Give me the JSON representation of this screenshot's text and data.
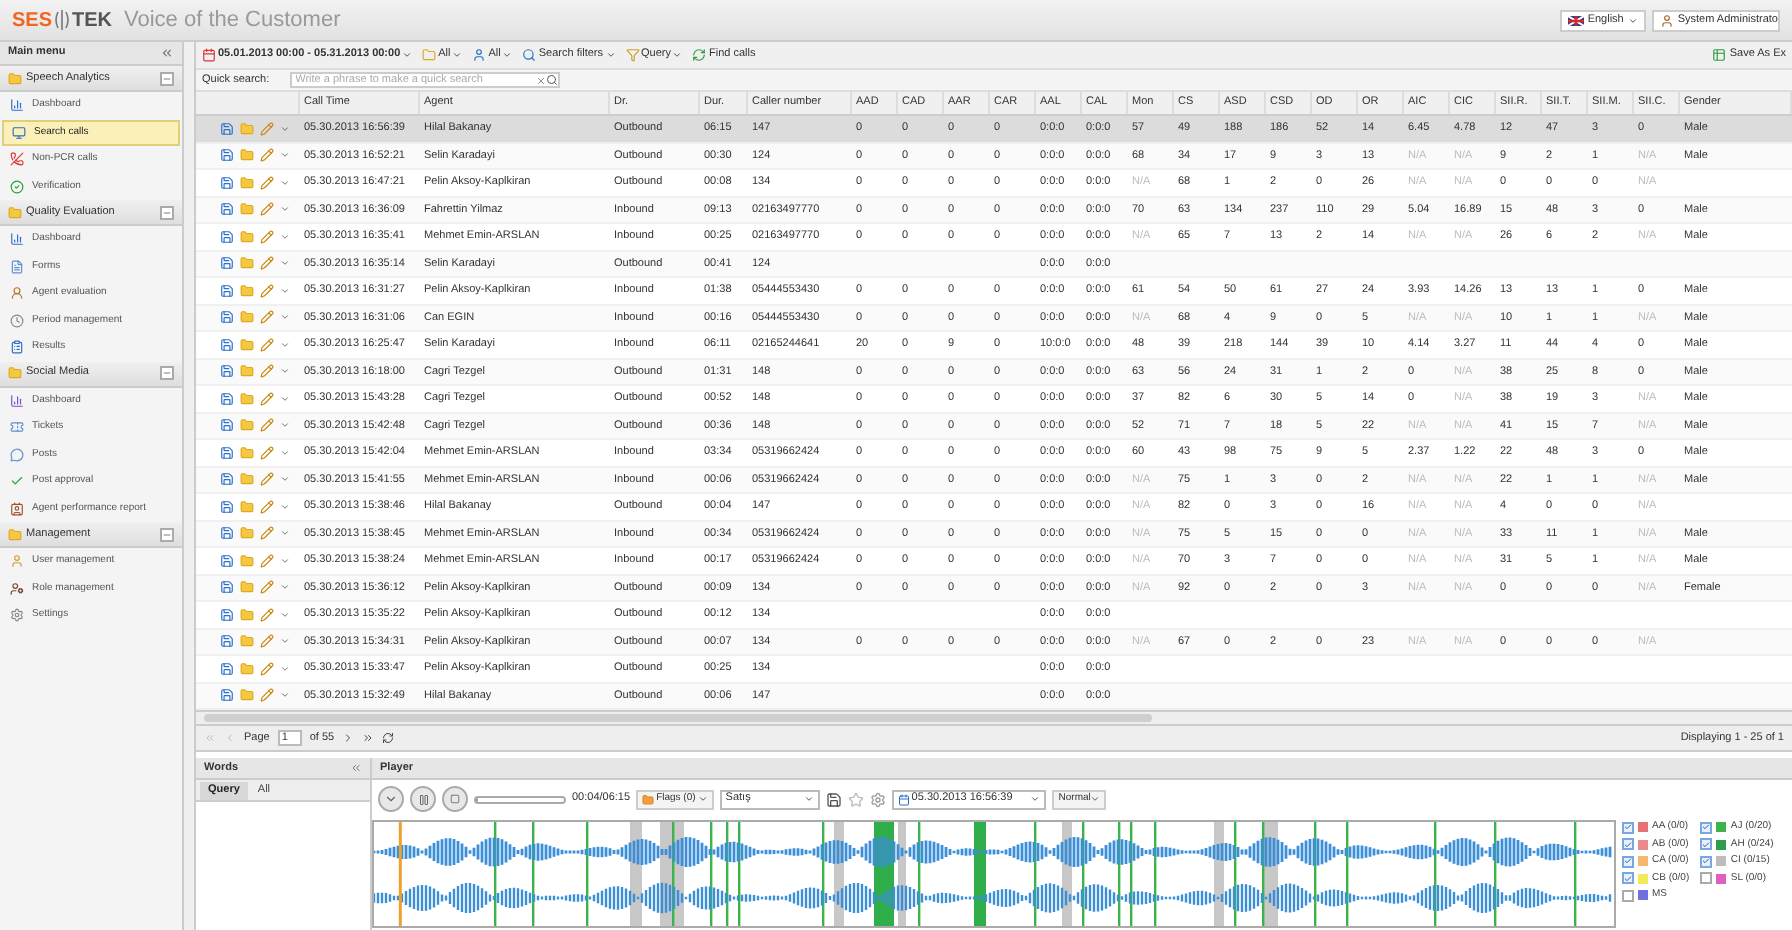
{
  "header": {
    "logo_left": "SES",
    "logo_right": "TEK",
    "title": "Voice of the Customer",
    "language": "English",
    "user": "System Administrato"
  },
  "sidebar": {
    "title": "Main menu",
    "groups": [
      {
        "label": "Speech Analytics",
        "expanded": true,
        "items": [
          {
            "label": "Dashboard",
            "selected": false
          },
          {
            "label": "Search calls",
            "selected": true
          },
          {
            "label": "Non-PCR calls",
            "selected": false
          },
          {
            "label": "Verification",
            "selected": false
          }
        ]
      },
      {
        "label": "Quality Evaluation",
        "expanded": true,
        "items": [
          {
            "label": "Dashboard",
            "selected": false
          },
          {
            "label": "Forms",
            "selected": false
          },
          {
            "label": "Agent evaluation",
            "selected": false
          },
          {
            "label": "Period management",
            "selected": false
          },
          {
            "label": "Results",
            "selected": false
          }
        ]
      },
      {
        "label": "Social Media",
        "expanded": true,
        "items": [
          {
            "label": "Dashboard",
            "selected": false
          },
          {
            "label": "Tickets",
            "selected": false
          },
          {
            "label": "Posts",
            "selected": false
          },
          {
            "label": "Post approval",
            "selected": false
          },
          {
            "label": "Agent performance report",
            "selected": false
          }
        ]
      },
      {
        "label": "Management",
        "expanded": true,
        "items": [
          {
            "label": "User management",
            "selected": false
          },
          {
            "label": "Role management",
            "selected": false
          },
          {
            "label": "Settings",
            "selected": false
          }
        ]
      }
    ]
  },
  "toolbar": {
    "date_range": "05.01.2013 00:00 - 05.31.2013 00:00",
    "filters": [
      "All",
      "All",
      "Search filters",
      "Query"
    ],
    "find": "Find calls",
    "export": "Save As Ex"
  },
  "quick_search": {
    "label": "Quick search:",
    "placeholder": "Write a phrase to make a quick search"
  },
  "table": {
    "columns": [
      "Call Time",
      "Agent",
      "Dr.",
      "Dur.",
      "Caller number",
      "AAD",
      "CAD",
      "AAR",
      "CAR",
      "AAL",
      "CAL",
      "Mon",
      "CS",
      "ASD",
      "CSD",
      "OD",
      "OR",
      "AIC",
      "CIC",
      "SII.R.",
      "SII.T.",
      "SII.M.",
      "SII.C.",
      "Gender"
    ],
    "rows": [
      {
        "selected": true,
        "cells": [
          "05.30.2013 16:56:39",
          "Hilal Bakanay",
          "Outbound",
          "06:15",
          "147",
          "0",
          "0",
          "0",
          "0",
          "0:0:0",
          "0:0:0",
          "57",
          "49",
          "188",
          "186",
          "52",
          "14",
          "6.45",
          "4.78",
          "12",
          "47",
          "3",
          "0",
          "Male"
        ]
      },
      {
        "selected": false,
        "cells": [
          "05.30.2013 16:52:21",
          "Selin Karadayi",
          "Outbound",
          "00:30",
          "124",
          "0",
          "0",
          "0",
          "0",
          "0:0:0",
          "0:0:0",
          "68",
          "34",
          "17",
          "9",
          "3",
          "13",
          {
            "text": "N/A",
            "dimmed": true
          },
          {
            "text": "N/A",
            "dimmed": true
          },
          "9",
          "2",
          "1",
          {
            "text": "N/A",
            "dimmed": true
          },
          "Male"
        ]
      },
      {
        "selected": false,
        "cells": [
          "05.30.2013 16:47:21",
          "Pelin Aksoy-Kaplkiran",
          "Outbound",
          "00:08",
          "134",
          "0",
          "0",
          "0",
          "0",
          "0:0:0",
          "0:0:0",
          {
            "text": "N/A",
            "dimmed": true
          },
          "68",
          "1",
          "2",
          "0",
          "26",
          {
            "text": "N/A",
            "dimmed": true
          },
          {
            "text": "N/A",
            "dimmed": true
          },
          "0",
          "0",
          "0",
          {
            "text": "N/A",
            "dimmed": true
          },
          null
        ]
      },
      {
        "selected": false,
        "cells": [
          "05.30.2013 16:36:09",
          "Fahrettin Yilmaz",
          "Inbound",
          "09:13",
          "02163497770",
          "0",
          "0",
          "0",
          "0",
          "0:0:0",
          "0:0:0",
          "70",
          "63",
          "134",
          "237",
          "110",
          "29",
          "5.04",
          "16.89",
          "15",
          "48",
          "3",
          "0",
          "Male"
        ]
      },
      {
        "selected": false,
        "cells": [
          "05.30.2013 16:35:41",
          "Mehmet Emin-ARSLAN",
          "Inbound",
          "00:25",
          "02163497770",
          "0",
          "0",
          "0",
          "0",
          "0:0:0",
          "0:0:0",
          {
            "text": "N/A",
            "dimmed": true
          },
          "65",
          "7",
          "13",
          "2",
          "14",
          {
            "text": "N/A",
            "dimmed": true
          },
          {
            "text": "N/A",
            "dimmed": true
          },
          "26",
          "6",
          "2",
          {
            "text": "N/A",
            "dimmed": true
          },
          "Male"
        ]
      },
      {
        "selected": false,
        "cells": [
          "05.30.2013 16:35:14",
          "Selin Karadayi",
          "Outbound",
          "00:41",
          "124",
          null,
          null,
          null,
          null,
          "0:0:0",
          "0:0:0",
          null,
          null,
          null,
          null,
          null,
          null,
          null,
          null,
          null,
          null,
          null,
          null,
          null
        ]
      },
      {
        "selected": false,
        "cells": [
          "05.30.2013 16:31:27",
          "Pelin Aksoy-Kaplkiran",
          "Inbound",
          "01:38",
          "05444553430",
          "0",
          "0",
          "0",
          "0",
          "0:0:0",
          "0:0:0",
          "61",
          "54",
          "50",
          "61",
          "27",
          "24",
          "3.93",
          "14.26",
          "13",
          "13",
          "1",
          "0",
          "Male"
        ]
      },
      {
        "selected": false,
        "cells": [
          "05.30.2013 16:31:06",
          "Can EGIN",
          "Inbound",
          "00:16",
          "05444553430",
          "0",
          "0",
          "0",
          "0",
          "0:0:0",
          "0:0:0",
          {
            "text": "N/A",
            "dimmed": true
          },
          "68",
          "4",
          "9",
          "0",
          "5",
          {
            "text": "N/A",
            "dimmed": true
          },
          {
            "text": "N/A",
            "dimmed": true
          },
          "10",
          "1",
          "1",
          {
            "text": "N/A",
            "dimmed": true
          },
          "Male"
        ]
      },
      {
        "selected": false,
        "cells": [
          "05.30.2013 16:25:47",
          "Selin Karadayi",
          "Inbound",
          "06:11",
          "02165244641",
          "20",
          "0",
          "9",
          "0",
          "10:0:0",
          "0:0:0",
          "48",
          "39",
          "218",
          "144",
          "39",
          "10",
          "4.14",
          "3.27",
          "11",
          "44",
          "4",
          "0",
          "Male"
        ]
      },
      {
        "selected": false,
        "cells": [
          "05.30.2013 16:18:00",
          "Cagri Tezgel",
          "Outbound",
          "01:31",
          "148",
          "0",
          "0",
          "0",
          "0",
          "0:0:0",
          "0:0:0",
          "63",
          "56",
          "24",
          "31",
          "1",
          "2",
          "0",
          {
            "text": "N/A",
            "dimmed": true
          },
          "38",
          "25",
          "8",
          "0",
          "Male"
        ]
      },
      {
        "selected": false,
        "cells": [
          "05.30.2013 15:43:28",
          "Cagri Tezgel",
          "Outbound",
          "00:52",
          "148",
          "0",
          "0",
          "0",
          "0",
          "0:0:0",
          "0:0:0",
          "37",
          "82",
          "6",
          "30",
          "5",
          "14",
          "0",
          {
            "text": "N/A",
            "dimmed": true
          },
          "38",
          "19",
          "3",
          {
            "text": "N/A",
            "dimmed": true
          },
          "Male"
        ]
      },
      {
        "selected": false,
        "cells": [
          "05.30.2013 15:42:48",
          "Cagri Tezgel",
          "Outbound",
          "00:36",
          "148",
          "0",
          "0",
          "0",
          "0",
          "0:0:0",
          "0:0:0",
          "52",
          "71",
          "7",
          "18",
          "5",
          "22",
          {
            "text": "N/A",
            "dimmed": true
          },
          {
            "text": "N/A",
            "dimmed": true
          },
          "41",
          "15",
          "7",
          {
            "text": "N/A",
            "dimmed": true
          },
          "Male"
        ]
      },
      {
        "selected": false,
        "cells": [
          "05.30.2013 15:42:04",
          "Mehmet Emin-ARSLAN",
          "Inbound",
          "03:34",
          "05319662424",
          "0",
          "0",
          "0",
          "0",
          "0:0:0",
          "0:0:0",
          "60",
          "43",
          "98",
          "75",
          "9",
          "5",
          "2.37",
          "1.22",
          "22",
          "48",
          "3",
          "0",
          "Male"
        ]
      },
      {
        "selected": false,
        "cells": [
          "05.30.2013 15:41:55",
          "Mehmet Emin-ARSLAN",
          "Inbound",
          "00:06",
          "05319662424",
          "0",
          "0",
          "0",
          "0",
          "0:0:0",
          "0:0:0",
          {
            "text": "N/A",
            "dimmed": true
          },
          "75",
          "1",
          "3",
          "0",
          "2",
          {
            "text": "N/A",
            "dimmed": true
          },
          {
            "text": "N/A",
            "dimmed": true
          },
          "22",
          "1",
          "1",
          {
            "text": "N/A",
            "dimmed": true
          },
          "Male"
        ]
      },
      {
        "selected": false,
        "cells": [
          "05.30.2013 15:38:46",
          "Hilal Bakanay",
          "Outbound",
          "00:04",
          "147",
          "0",
          "0",
          "0",
          "0",
          "0:0:0",
          "0:0:0",
          {
            "text": "N/A",
            "dimmed": true
          },
          "82",
          "0",
          "3",
          "0",
          "16",
          {
            "text": "N/A",
            "dimmed": true
          },
          {
            "text": "N/A",
            "dimmed": true
          },
          "4",
          "0",
          "0",
          {
            "text": "N/A",
            "dimmed": true
          },
          null
        ]
      },
      {
        "selected": false,
        "cells": [
          "05.30.2013 15:38:45",
          "Mehmet Emin-ARSLAN",
          "Inbound",
          "00:34",
          "05319662424",
          "0",
          "0",
          "0",
          "0",
          "0:0:0",
          "0:0:0",
          {
            "text": "N/A",
            "dimmed": true
          },
          "75",
          "5",
          "15",
          "0",
          "0",
          {
            "text": "N/A",
            "dimmed": true
          },
          {
            "text": "N/A",
            "dimmed": true
          },
          "33",
          "11",
          "1",
          {
            "text": "N/A",
            "dimmed": true
          },
          "Male"
        ]
      },
      {
        "selected": false,
        "cells": [
          "05.30.2013 15:38:24",
          "Mehmet Emin-ARSLAN",
          "Inbound",
          "00:17",
          "05319662424",
          "0",
          "0",
          "0",
          "0",
          "0:0:0",
          "0:0:0",
          {
            "text": "N/A",
            "dimmed": true
          },
          "70",
          "3",
          "7",
          "0",
          "0",
          {
            "text": "N/A",
            "dimmed": true
          },
          {
            "text": "N/A",
            "dimmed": true
          },
          "31",
          "5",
          "1",
          {
            "text": "N/A",
            "dimmed": true
          },
          "Male"
        ]
      },
      {
        "selected": false,
        "cells": [
          "05.30.2013 15:36:12",
          "Pelin Aksoy-Kaplkiran",
          "Outbound",
          "00:09",
          "134",
          "0",
          "0",
          "0",
          "0",
          "0:0:0",
          "0:0:0",
          {
            "text": "N/A",
            "dimmed": true
          },
          "92",
          "0",
          "2",
          "0",
          "3",
          {
            "text": "N/A",
            "dimmed": true
          },
          {
            "text": "N/A",
            "dimmed": true
          },
          "0",
          "0",
          "0",
          {
            "text": "N/A",
            "dimmed": true
          },
          "Female"
        ]
      },
      {
        "selected": false,
        "cells": [
          "05.30.2013 15:35:22",
          "Pelin Aksoy-Kaplkiran",
          "Outbound",
          "00:12",
          "134",
          null,
          null,
          null,
          null,
          "0:0:0",
          "0:0:0",
          null,
          null,
          null,
          null,
          null,
          null,
          null,
          null,
          null,
          null,
          null,
          null,
          null
        ]
      },
      {
        "selected": false,
        "cells": [
          "05.30.2013 15:34:31",
          "Pelin Aksoy-Kaplkiran",
          "Outbound",
          "00:07",
          "134",
          "0",
          "0",
          "0",
          "0",
          "0:0:0",
          "0:0:0",
          {
            "text": "N/A",
            "dimmed": true
          },
          "67",
          "0",
          "2",
          "0",
          "23",
          {
            "text": "N/A",
            "dimmed": true
          },
          {
            "text": "N/A",
            "dimmed": true
          },
          "0",
          "0",
          "0",
          {
            "text": "N/A",
            "dimmed": true
          },
          null
        ]
      },
      {
        "selected": false,
        "cells": [
          "05.30.2013 15:33:47",
          "Pelin Aksoy-Kaplkiran",
          "Outbound",
          "00:25",
          "134",
          null,
          null,
          null,
          null,
          "0:0:0",
          "0:0:0",
          null,
          null,
          null,
          null,
          null,
          null,
          null,
          null,
          null,
          null,
          null,
          null,
          null
        ]
      },
      {
        "selected": false,
        "cells": [
          "05.30.2013 15:32:49",
          "Hilal Bakanay",
          "Outbound",
          "00:06",
          "147",
          null,
          null,
          null,
          null,
          "0:0:0",
          "0:0:0",
          null,
          null,
          null,
          null,
          null,
          null,
          null,
          null,
          null,
          null,
          null,
          null,
          null
        ]
      }
    ]
  },
  "pager": {
    "page_label": "Page",
    "page": "1",
    "of": "of 55",
    "displaying": "Displaying 1 - 25 of 1"
  },
  "words": {
    "title": "Words",
    "tabs": [
      {
        "label": "Query",
        "selected": true
      },
      {
        "label": "All",
        "selected": false
      }
    ]
  },
  "player": {
    "title": "Player",
    "level": 0.02,
    "time": "00:04/06:15",
    "flags": "Flags (0)",
    "category": "Satış",
    "date": "05.30.2013 16:56:39",
    "speed": "Normal",
    "legend": [
      {
        "label": "AA (0/0)",
        "color": "#e57373",
        "checked": true
      },
      {
        "label": "AJ (0/20)",
        "color": "#3cb44b",
        "checked": true
      },
      {
        "label": "AB (0/0)",
        "color": "#ea8a8a",
        "checked": true
      },
      {
        "label": "AH (0/24)",
        "color": "#2e9e4a",
        "checked": true
      },
      {
        "label": "CA (0/0)",
        "color": "#f5b870",
        "checked": true
      },
      {
        "label": "CI (0/15)",
        "color": "#bdbdbd",
        "checked": true
      },
      {
        "label": "CB (0/0)",
        "color": "#f2ea5a",
        "checked": true
      },
      {
        "label": "SL (0/0)",
        "color": "#e060c0",
        "checked": false
      },
      {
        "label": "MS",
        "color": "#7070e0",
        "checked": false
      }
    ]
  }
}
